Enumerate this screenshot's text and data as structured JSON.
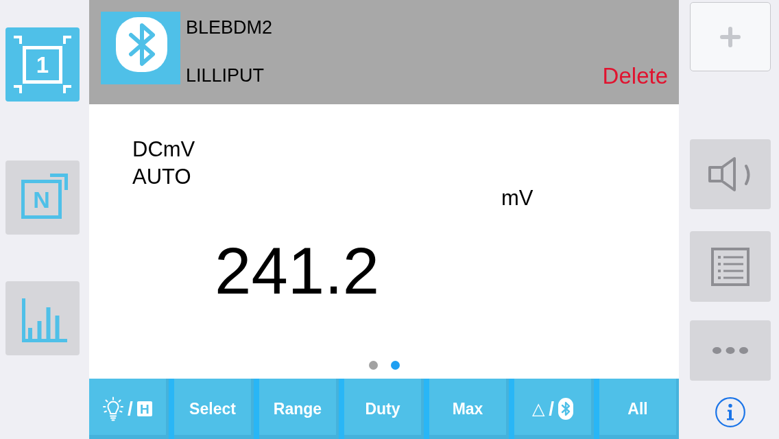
{
  "left_sidebar": [
    {
      "kind": "single",
      "label": "1",
      "selected": true
    },
    {
      "kind": "multi",
      "label": "N",
      "selected": false
    },
    {
      "kind": "chart",
      "selected": false
    }
  ],
  "device": {
    "title": "BLEBDM2",
    "subtitle": "LILLIPUT",
    "delete_label": "Delete"
  },
  "reading": {
    "mode": "DCmV",
    "range": "AUTO",
    "unit": "mV",
    "value": "241.2"
  },
  "page_dots": [
    {
      "selected": false
    },
    {
      "selected": true
    }
  ],
  "toolbar": [
    {
      "kind": "light-hold",
      "separator": "/",
      "badge": "H"
    },
    {
      "kind": "text",
      "label": "Select"
    },
    {
      "kind": "text",
      "label": "Range"
    },
    {
      "kind": "text",
      "label": "Duty"
    },
    {
      "kind": "text",
      "label": "Max"
    },
    {
      "kind": "delta-bluetooth",
      "symbol": "△",
      "separator": "/"
    },
    {
      "kind": "text",
      "label": "All"
    }
  ],
  "right_sidebar": [
    {
      "kind": "add"
    },
    {
      "kind": "speaker"
    },
    {
      "kind": "list"
    },
    {
      "kind": "more"
    },
    {
      "kind": "info"
    }
  ]
}
